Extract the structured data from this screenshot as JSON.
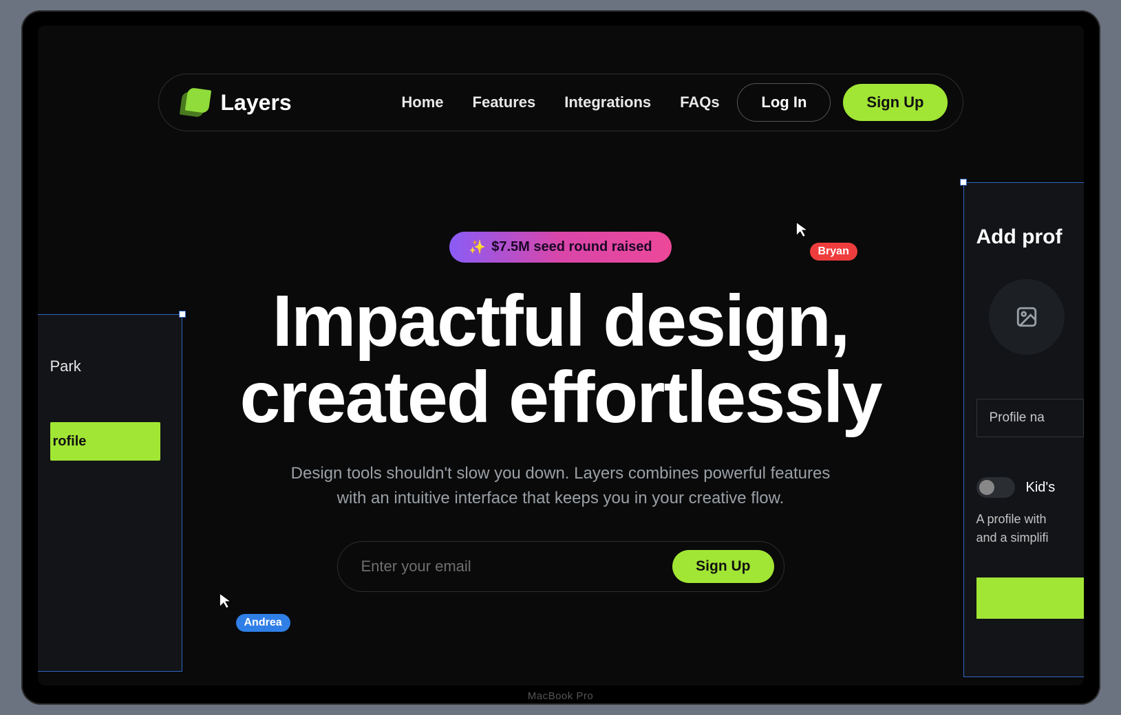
{
  "hardware_label": "MacBook Pro",
  "brand": "Layers",
  "nav": {
    "links": [
      "Home",
      "Features",
      "Integrations",
      "FAQs"
    ],
    "login": "Log In",
    "signup": "Sign Up"
  },
  "hero": {
    "pill_emoji": "✨",
    "pill_text": "$7.5M seed round raised",
    "title_line1": "Impactful design,",
    "title_line2": "created effortlessly",
    "subtitle": "Design tools shouldn't slow you down. Layers combines powerful features with an intuitive interface that keeps you in your creative flow.",
    "email_placeholder": "Enter your email",
    "email_cta": "Sign Up"
  },
  "cursors": {
    "bryan": "Bryan",
    "andrea": "Andrea"
  },
  "left_panel": {
    "name_fragment": "Park",
    "button_fragment": "rofile"
  },
  "right_panel": {
    "title_fragment": "Add prof",
    "field_placeholder_fragment": "Profile na",
    "toggle_label_fragment": "Kid's",
    "desc_line1": "A profile with",
    "desc_line2": "and a simplifi"
  },
  "colors": {
    "accent": "#a2e635",
    "bg": "#0a0a0a",
    "cursor_red": "#ef3d3d",
    "cursor_blue": "#2f7fe6"
  }
}
